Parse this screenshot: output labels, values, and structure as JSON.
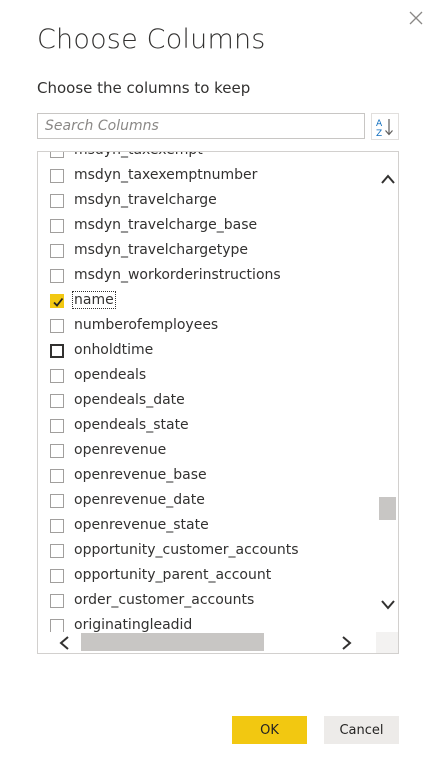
{
  "dialog": {
    "title": "Choose Columns",
    "subtitle": "Choose the columns to keep"
  },
  "search": {
    "placeholder": "Search Columns",
    "value": ""
  },
  "sort": {
    "icon": "sort-az-icon",
    "letters": "AZ"
  },
  "columns": [
    {
      "label": "msdyn_taxexempt",
      "checked": false,
      "focused": false
    },
    {
      "label": "msdyn_taxexemptnumber",
      "checked": false,
      "focused": false
    },
    {
      "label": "msdyn_travelcharge",
      "checked": false,
      "focused": false
    },
    {
      "label": "msdyn_travelcharge_base",
      "checked": false,
      "focused": false
    },
    {
      "label": "msdyn_travelchargetype",
      "checked": false,
      "focused": false
    },
    {
      "label": "msdyn_workorderinstructions",
      "checked": false,
      "focused": false
    },
    {
      "label": "name",
      "checked": true,
      "focused": false
    },
    {
      "label": "numberofemployees",
      "checked": false,
      "focused": false
    },
    {
      "label": "onholdtime",
      "checked": false,
      "focused": true
    },
    {
      "label": "opendeals",
      "checked": false,
      "focused": false
    },
    {
      "label": "opendeals_date",
      "checked": false,
      "focused": false
    },
    {
      "label": "opendeals_state",
      "checked": false,
      "focused": false
    },
    {
      "label": "openrevenue",
      "checked": false,
      "focused": false
    },
    {
      "label": "openrevenue_base",
      "checked": false,
      "focused": false
    },
    {
      "label": "openrevenue_date",
      "checked": false,
      "focused": false
    },
    {
      "label": "openrevenue_state",
      "checked": false,
      "focused": false
    },
    {
      "label": "opportunity_customer_accounts",
      "checked": false,
      "focused": false
    },
    {
      "label": "opportunity_parent_account",
      "checked": false,
      "focused": false
    },
    {
      "label": "order_customer_accounts",
      "checked": false,
      "focused": false
    },
    {
      "label": "originatingleadid",
      "checked": false,
      "focused": false
    }
  ],
  "buttons": {
    "ok": "OK",
    "cancel": "Cancel"
  },
  "colors": {
    "accent": "#f2c811",
    "secondary_button": "#edebe9",
    "border": "#d2d0ce"
  }
}
